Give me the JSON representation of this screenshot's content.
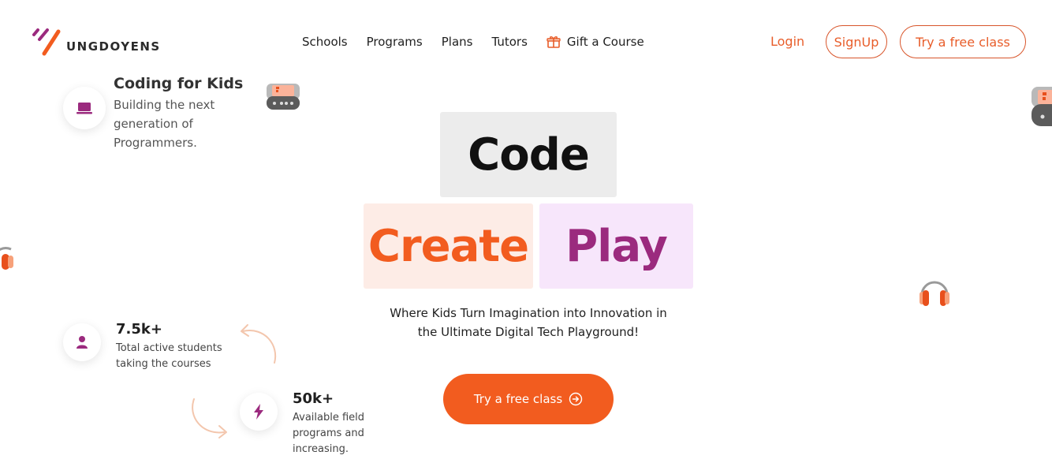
{
  "brand": {
    "logo_text": "UNGDOYENS"
  },
  "nav": {
    "items": [
      "Schools",
      "Programs",
      "Plans",
      "Tutors"
    ],
    "gift_label": "Gift a Course"
  },
  "header_actions": {
    "login": "Login",
    "signup": "SignUp",
    "try_free": "Try a free class"
  },
  "feature": {
    "title": "Coding for Kids",
    "description_lines": [
      "Building the next",
      "generation of",
      "Programmers."
    ],
    "icon": "laptop-icon"
  },
  "hero": {
    "words": [
      "Code",
      "Create",
      "Play"
    ],
    "tagline_lines": [
      "Where Kids Turn Imagination into Innovation in",
      "the Ultimate Digital Tech Playground!"
    ],
    "cta_label": "Try a free class"
  },
  "stats": [
    {
      "value": "7.5k+",
      "lines": [
        "Total active students",
        "taking the courses"
      ],
      "icon": "user-icon"
    },
    {
      "value": "50k+",
      "lines": [
        "Available field",
        "programs and",
        "increasing."
      ],
      "icon": "lightning-icon"
    }
  ],
  "colors": {
    "accent_orange": "#f25c1f",
    "accent_purple": "#9b2a7e",
    "create_bg": "#fdece6",
    "play_bg": "#f7e6fb",
    "code_bg": "#ececec"
  }
}
